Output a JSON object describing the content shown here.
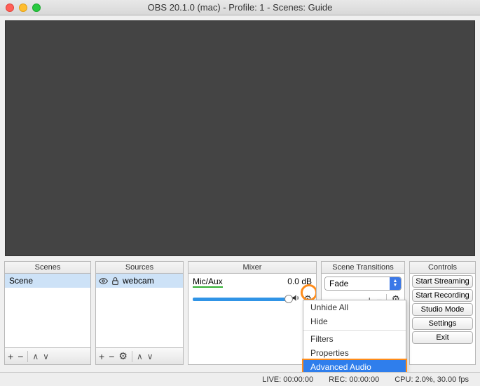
{
  "titlebar": {
    "title": "OBS 20.1.0 (mac) - Profile: 1 - Scenes: Guide"
  },
  "panels": {
    "scenes": {
      "header": "Scenes",
      "items": [
        "Scene"
      ]
    },
    "sources": {
      "header": "Sources",
      "items": [
        {
          "label": "webcam"
        }
      ]
    },
    "mixer": {
      "header": "Mixer",
      "channel": {
        "name": "Mic/Aux",
        "level": "0.0 dB"
      }
    },
    "transitions": {
      "header": "Scene Transitions",
      "selected": "Fade"
    },
    "controls": {
      "header": "Controls",
      "buttons": {
        "start_streaming": "Start Streaming",
        "start_recording": "Start Recording",
        "studio_mode": "Studio Mode",
        "settings": "Settings",
        "exit": "Exit"
      }
    }
  },
  "context_menu": {
    "unhide_all": "Unhide All",
    "hide": "Hide",
    "filters": "Filters",
    "properties": "Properties",
    "advanced_audio": "Advanced Audio Properties"
  },
  "statusbar": {
    "live": "LIVE: 00:00:00",
    "rec": "REC: 00:00:00",
    "cpu": "CPU: 2.0%, 30.00 fps"
  },
  "icons": {
    "plus": "+",
    "minus": "−",
    "up": "∧",
    "down": "∨",
    "gear": "⚙"
  }
}
